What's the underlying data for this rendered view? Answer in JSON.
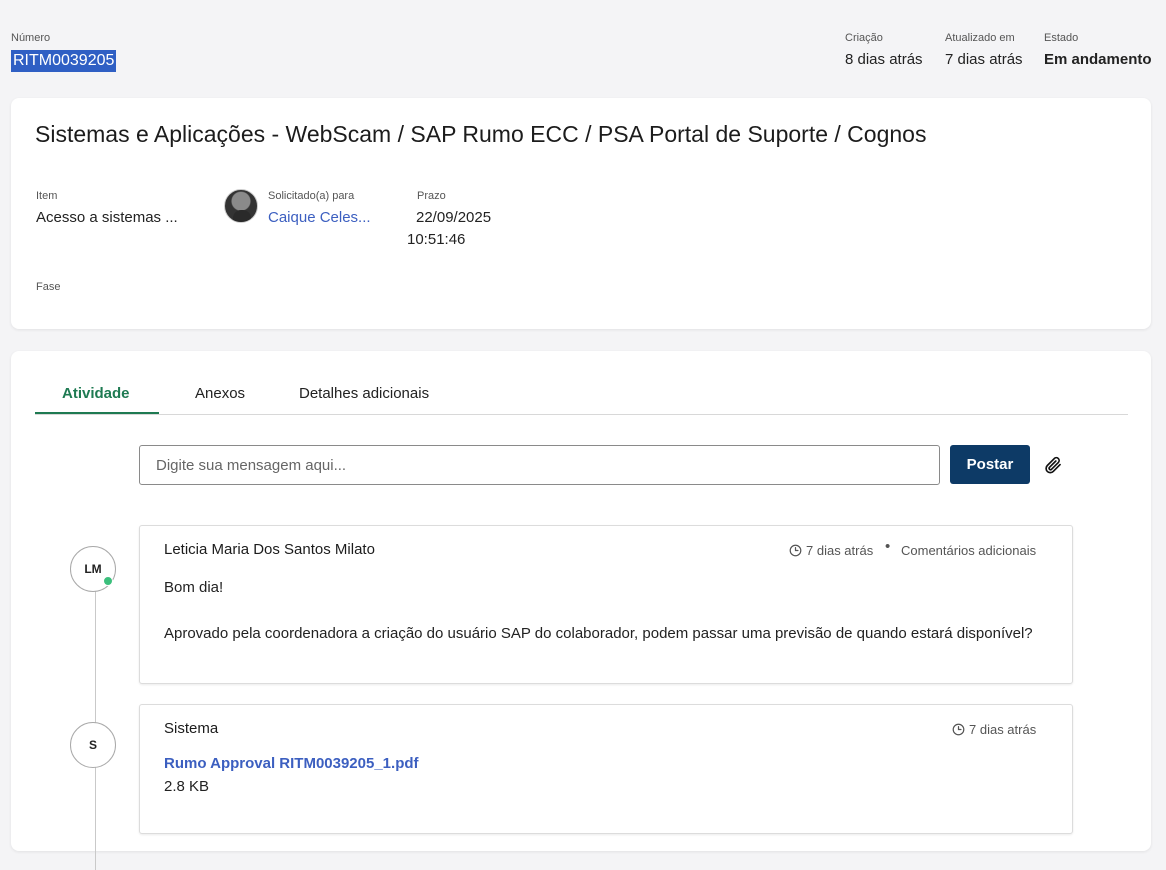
{
  "header": {
    "number_label": "Número",
    "number_value": "RITM0039205",
    "created_label": "Criação",
    "created_value": "8 dias atrás",
    "updated_label": "Atualizado em",
    "updated_value": "7 dias atrás",
    "state_label": "Estado",
    "state_value": "Em andamento"
  },
  "summary": {
    "title": "Sistemas e Aplicações - WebScam / SAP Rumo ECC / PSA Portal de Suporte / Cognos",
    "item_label": "Item",
    "item_value": "Acesso a sistemas ...",
    "requested_for_label": "Solicitado(a) para",
    "requested_for_value": "Caique Celes...",
    "due_label": "Prazo",
    "due_date": "22/09/2025",
    "due_time": "10:51:46",
    "phase_label": "Fase"
  },
  "tabs": [
    {
      "label": "Atividade",
      "active": true
    },
    {
      "label": "Anexos",
      "active": false
    },
    {
      "label": "Detalhes adicionais",
      "active": false
    }
  ],
  "composer": {
    "placeholder": "Digite sua mensagem aqui...",
    "post_label": "Postar",
    "attach_icon": "paperclip-icon"
  },
  "activity": [
    {
      "initials": "LM",
      "online": true,
      "author": "Leticia Maria Dos Santos Milato",
      "time": "7 dias atrás",
      "separator": "•",
      "kind": "Comentários adicionais",
      "line1": "Bom dia!",
      "line2": "Aprovado pela coordenadora a criação do usuário SAP do colaborador, podem passar uma previsão de quando estará disponível?"
    },
    {
      "initials": "S",
      "author": "Sistema",
      "time": "7 dias atrás",
      "file_name": "Rumo Approval RITM0039205_1.pdf",
      "file_size": "2.8 KB"
    }
  ],
  "colors": {
    "accent_green": "#1e7a52",
    "primary_button": "#0d3a66",
    "link_blue": "#3c5fc0",
    "online_dot": "#3bbf7c"
  }
}
